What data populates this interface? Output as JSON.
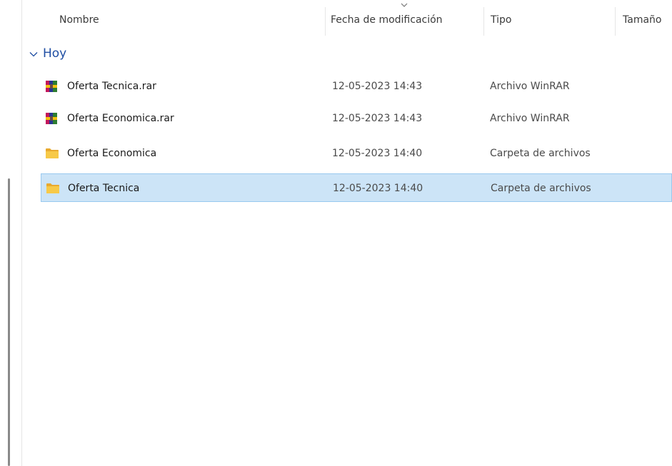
{
  "columns": {
    "name": "Nombre",
    "modified": "Fecha de modificación",
    "type": "Tipo",
    "size": "Tamaño"
  },
  "group": {
    "label": "Hoy",
    "icon": "chevron-down-icon"
  },
  "files": [
    {
      "name": "Oferta Tecnica.rar",
      "modified": "12-05-2023 14:43",
      "type": "Archivo WinRAR",
      "icon": "winrar-archive-icon"
    },
    {
      "name": "Oferta Economica.rar",
      "modified": "12-05-2023 14:43",
      "type": "Archivo WinRAR",
      "icon": "winrar-archive-icon"
    },
    {
      "name": "Oferta Economica",
      "modified": "12-05-2023 14:40",
      "type": "Carpeta de archivos",
      "icon": "folder-icon"
    },
    {
      "name": "Oferta Tecnica",
      "modified": "12-05-2023 14:40",
      "type": "Carpeta de archivos",
      "icon": "folder-icon",
      "selected": true
    }
  ],
  "colors": {
    "selection_bg": "#cce4f7",
    "selection_border": "#99c9ef",
    "group_text": "#1f4ea3",
    "folder": "#f7c948"
  }
}
